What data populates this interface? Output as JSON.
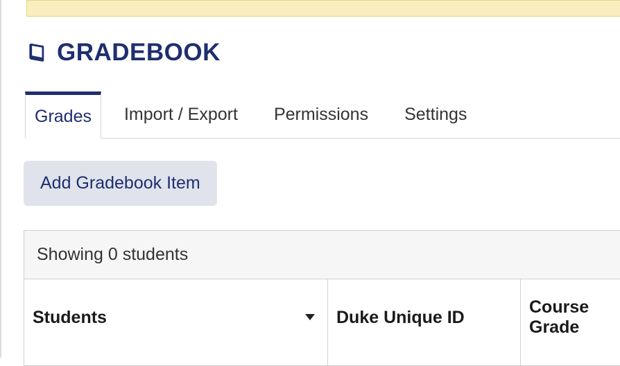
{
  "header": {
    "title": "GRADEBOOK"
  },
  "tabs": {
    "items": [
      {
        "label": "Grades",
        "active": true
      },
      {
        "label": "Import / Export",
        "active": false
      },
      {
        "label": "Permissions",
        "active": false
      },
      {
        "label": "Settings",
        "active": false
      }
    ]
  },
  "actions": {
    "add_item": "Add Gradebook Item"
  },
  "table": {
    "status": "Showing 0 students",
    "columns": [
      {
        "label": "Students",
        "sortable": true
      },
      {
        "label": "Duke Unique ID",
        "sortable": false
      },
      {
        "label": "Course Grade",
        "sortable": false
      }
    ],
    "rows": []
  }
}
